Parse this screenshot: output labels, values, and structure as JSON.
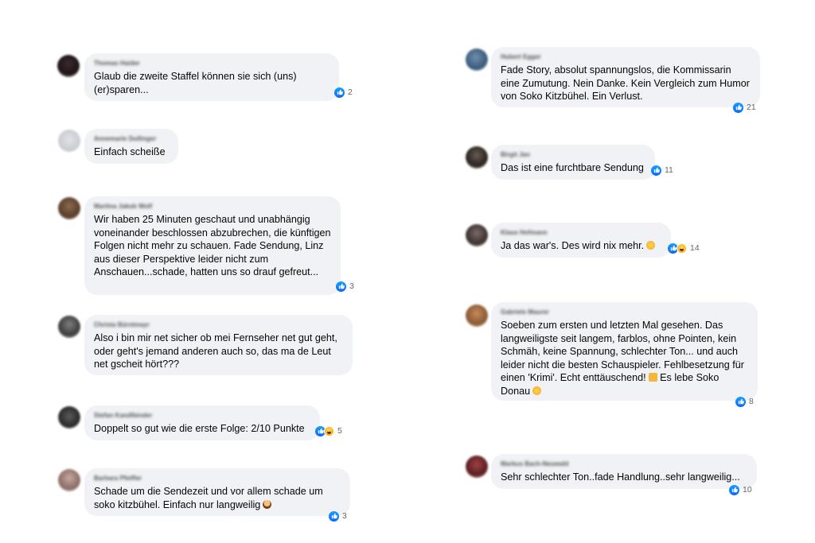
{
  "colors": {
    "bubble": "#f0f2f5",
    "like": "#1877f2",
    "text": "#050505",
    "meta": "#65676b"
  },
  "comments": [
    {
      "author": "Thomas Haider",
      "text": "Glaub die zweite Staffel können sie sich (uns) (er)sparen...",
      "reactions": [
        "like-icon"
      ],
      "count": "2"
    },
    {
      "author": "Annemarie Dullinger",
      "text": "Einfach scheiße",
      "reactions": [],
      "count": ""
    },
    {
      "author": "Martina Jakob Wolf",
      "text": "Wir haben 25 Minuten geschaut und unabhängig voneinander beschlossen abzubrechen, die künftigen Folgen nicht mehr zu schauen. Fade Sendung, Linz aus dieser Perspektive leider nicht zum Anschauen...schade, hatten uns so drauf gefreut...",
      "reactions": [
        "like-icon"
      ],
      "count": "3"
    },
    {
      "author": "Christa Bürstmayr",
      "text": "Also i bin mir net sicher ob mei Fernseher net gut geht, oder geht's jemand anderen auch so, das ma de Leut net gscheit hört???",
      "reactions": [],
      "count": ""
    },
    {
      "author": "Stefan Kandlbinder",
      "text": "Doppelt so gut wie die erste Folge: 2/10 Punkte",
      "reactions": [
        "like-icon",
        "haha-icon"
      ],
      "count": "5"
    },
    {
      "author": "Barbara Pfeiffer",
      "text": "Schade um die Sendezeit und vor allem schade um soko kitzbühel. Einfach nur langweilig",
      "trailing_emoji": "woman-shrugging-emoji",
      "reactions": [
        "like-icon"
      ],
      "count": "3"
    },
    {
      "author": "Hubert Egger",
      "text": "Fade Story, absolut spannungslos, die Kommissarin eine Zumutung. Nein Danke. Kein Vergleich zum Humor von Soko Kitzbühel. Ein Verlust.",
      "reactions": [
        "like-icon"
      ],
      "count": "21"
    },
    {
      "author": "Birgit Jan",
      "text": "Das ist eine furchtbare Sendung",
      "reactions": [
        "like-icon"
      ],
      "count": "11"
    },
    {
      "author": "Klaus Hofmann",
      "text": "Ja das war's. Des wird nix mehr.",
      "trailing_emoji": "sad-face-emoji",
      "reactions": [
        "like-icon",
        "haha-icon"
      ],
      "count": "14"
    },
    {
      "author": "Gabriele Maurer",
      "text": "Soeben zum ersten und letzten Mal gesehen. Das langweiligste seit langem, farblos, ohne Pointen, kein Schmäh, keine Spannung, schlechter Ton... und auch leider nicht die besten Schauspieler. Fehlbesetzung für einen 'Krimi'. Echt enttäuschend!",
      "trailing_text": "Es lebe Soko Donau",
      "mid_emoji": "thumbs-down-emoji",
      "trailing_emoji": "wink-face-emoji",
      "reactions": [
        "like-icon"
      ],
      "count": "8"
    },
    {
      "author": "Markus Bach-Neuwald",
      "text": "Sehr schlechter Ton..fade Handlung..sehr langweilig...",
      "reactions": [
        "like-icon"
      ],
      "count": "10"
    }
  ]
}
